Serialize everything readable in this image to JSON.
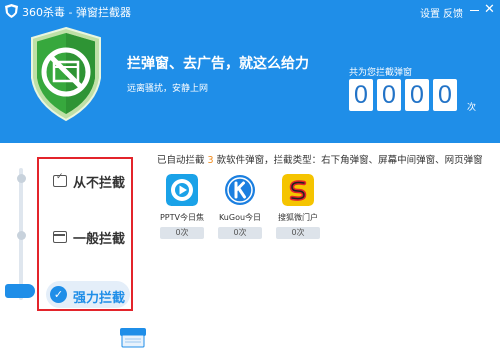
{
  "window": {
    "title": "360杀毒 - 弹窗拦截器",
    "settings": "设置",
    "feedback": "反馈"
  },
  "hero": {
    "headline": "拦弹窗、去广告，就这么给力",
    "subline": "远离骚扰，安静上网"
  },
  "counter": {
    "label": "共为您拦截弹窗",
    "digits": [
      "0",
      "0",
      "0",
      "0"
    ],
    "unit": "次"
  },
  "modes": [
    {
      "label": "从不拦截",
      "selected": false
    },
    {
      "label": "一般拦截",
      "selected": false
    },
    {
      "label": "强力拦截",
      "selected": true
    }
  ],
  "summary": {
    "prefix": "已自动拦截",
    "count": "3",
    "suffix": "款软件弹窗，拦截类型：右下角弹窗、屏幕中间弹窗、网页弹窗"
  },
  "apps": [
    {
      "name": "PPTV今日焦",
      "count": "0次",
      "icon": "pptv-icon"
    },
    {
      "name": "KuGou今日",
      "count": "0次",
      "icon": "kugou-icon"
    },
    {
      "name": "搜狐微门户",
      "count": "0次",
      "icon": "sohu-icon"
    }
  ],
  "colors": {
    "accent": "#1f8ee8",
    "highlight_box": "#e3242b",
    "count_orange": "#f08a1c",
    "shield_green": "#37a83d"
  }
}
